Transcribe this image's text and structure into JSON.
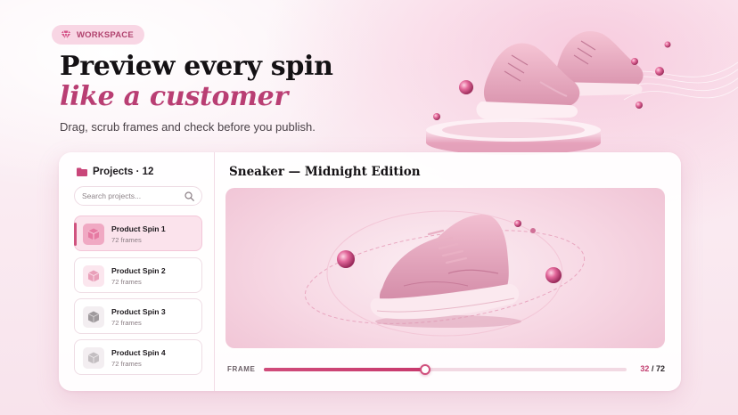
{
  "badge": {
    "label": "WORKSPACE",
    "icon": "gem-icon"
  },
  "hero": {
    "title_line1": "Preview every spin",
    "title_line2": "like a customer",
    "subtitle": "Drag, scrub frames and check before you publish."
  },
  "sidebar": {
    "header": "Projects · 12",
    "search_placeholder": "Search projects...",
    "items": [
      {
        "name": "Product Spin 1",
        "frames": "72 frames",
        "icon": "cube-icon",
        "active": true
      },
      {
        "name": "Product Spin 2",
        "frames": "72 frames",
        "icon": "cube-icon",
        "active": false
      },
      {
        "name": "Product Spin 3",
        "frames": "72 frames",
        "icon": "cube-icon",
        "active": false
      },
      {
        "name": "Product Spin 4",
        "frames": "72 frames",
        "icon": "cube-icon",
        "active": false
      }
    ]
  },
  "viewer": {
    "title": "Sneaker — Midnight Edition"
  },
  "scrubber": {
    "label": "FRAME",
    "current": "32",
    "separator": "/",
    "total": "72",
    "progress": 0.444
  },
  "colors": {
    "accent": "#c23e70",
    "accent_soft": "#fbe3ec",
    "background": "#fcf3f7"
  }
}
